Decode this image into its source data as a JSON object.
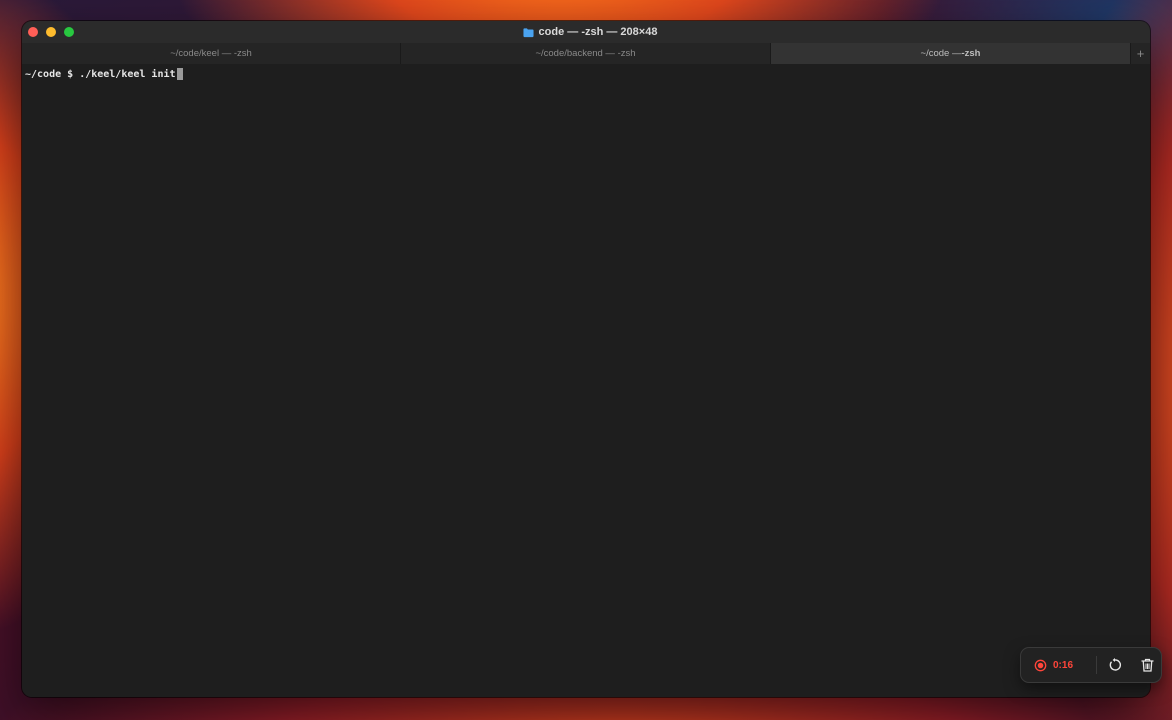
{
  "window": {
    "title": "code — -zsh — 208×48",
    "folder_icon": "folder-icon"
  },
  "tabs": [
    {
      "label": "~/code/keel — -zsh",
      "active": false
    },
    {
      "label": "~/code/backend — -zsh",
      "active": false
    },
    {
      "label_prefix": "~/code — ",
      "label_bold": "-zsh",
      "active": true
    }
  ],
  "tab_add_label": "+",
  "terminal": {
    "prompt": "~/code $ ",
    "command": "./keel/keel init"
  },
  "recorder": {
    "time": "0:16",
    "record_icon": "record-icon",
    "restart_icon": "restart-icon",
    "trash_icon": "trash-icon",
    "accent_color": "#ff453a"
  },
  "colors": {
    "close": "#ff5f57",
    "minimize": "#febc2e",
    "maximize": "#28c840",
    "folder": "#4aa3f0"
  }
}
